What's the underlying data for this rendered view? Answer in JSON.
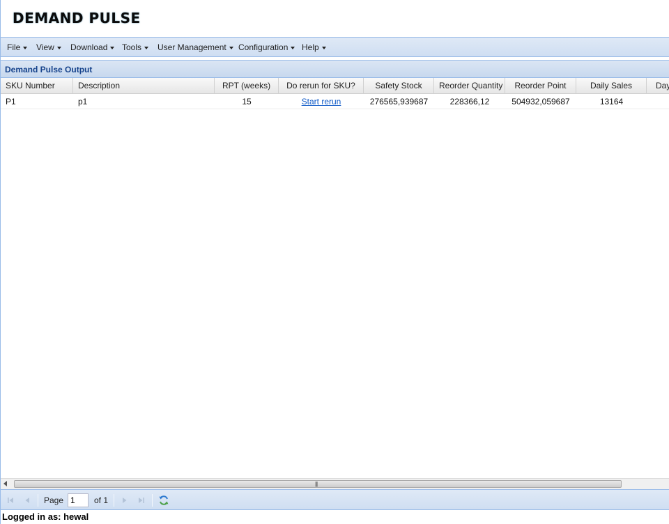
{
  "app": {
    "title": "DEMAND PULSE"
  },
  "menu": {
    "items": [
      {
        "label": "File"
      },
      {
        "label": "View"
      },
      {
        "label": "Download"
      },
      {
        "label": "Tools"
      },
      {
        "label": "User Management"
      },
      {
        "label": "Configuration"
      },
      {
        "label": "Help"
      }
    ]
  },
  "panel": {
    "title": "Demand Pulse Output"
  },
  "grid": {
    "columns": [
      "SKU Number",
      "Description",
      "RPT (weeks)",
      "Do rerun for SKU?",
      "Safety Stock",
      "Reorder Quantity",
      "Reorder Point",
      "Daily Sales",
      "Day"
    ],
    "rows": [
      {
        "sku": "P1",
        "description": "p1",
        "rpt": "15",
        "rerun": "Start rerun",
        "safety_stock": "276565,939687",
        "reorder_quantity": "228366,12",
        "reorder_point": "504932,059687",
        "daily_sales": "13164"
      }
    ]
  },
  "pager": {
    "page_label": "Page",
    "page_value": "1",
    "of_label": "of 1",
    "icons": [
      "first-page-icon",
      "prev-page-icon",
      "next-page-icon",
      "last-page-icon",
      "refresh-icon"
    ]
  },
  "status": {
    "text": "Logged in as: hewal"
  },
  "colors": {
    "accent": "#15428b",
    "toolbar": "#cfdef2",
    "border": "#99bbe8",
    "link": "#0b57c6"
  }
}
